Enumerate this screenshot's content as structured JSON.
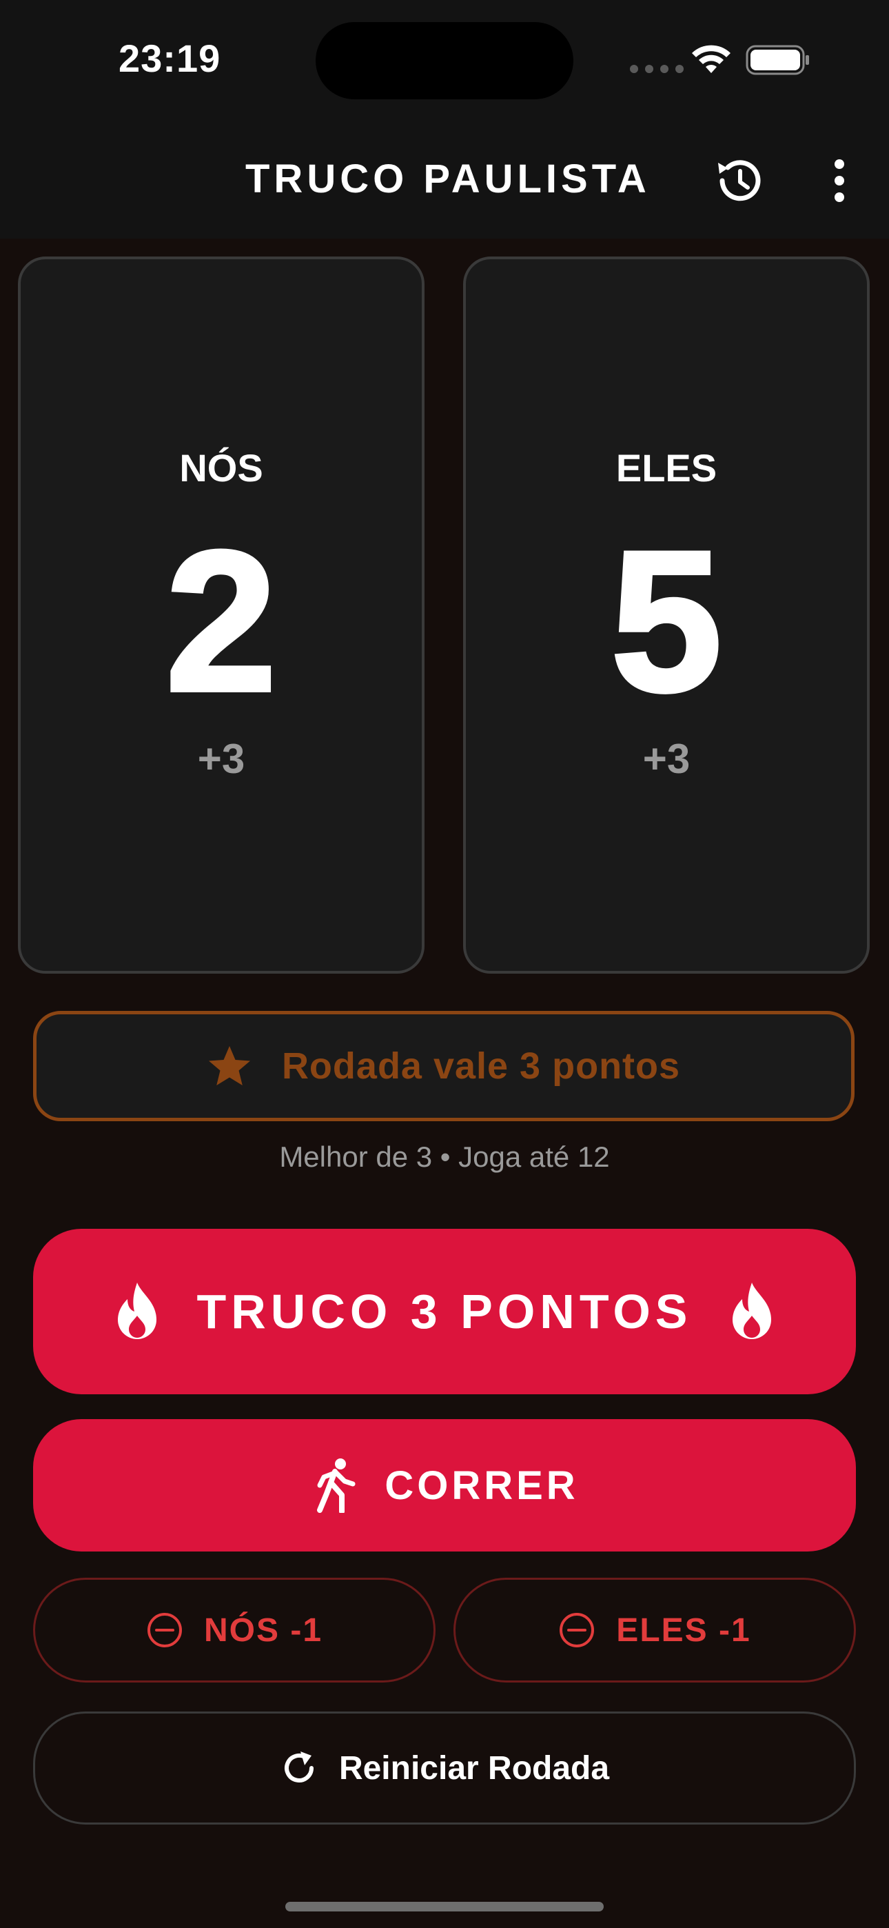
{
  "status_bar": {
    "time": "23:19"
  },
  "app_bar": {
    "title": "TRUCO PAULISTA",
    "history_icon": "history-icon",
    "menu_icon": "more-vertical-icon"
  },
  "teams": [
    {
      "name": "NÓS",
      "score": "2",
      "bonus": "+3"
    },
    {
      "name": "ELES",
      "score": "5",
      "bonus": "+3"
    }
  ],
  "round": {
    "label": "Rodada vale 3 pontos",
    "icon": "star-icon"
  },
  "match_info": "Melhor de 3 • Joga até 12",
  "actions": {
    "truco_label": "TRUCO 3 PONTOS",
    "run_label": "CORRER",
    "us_minus_label": "NÓS -1",
    "them_minus_label": "ELES -1",
    "reset_label": "Reiniciar Rodada"
  },
  "colors": {
    "background": "#150d0b",
    "card": "#1a1a1a",
    "accent_red": "#dc143c",
    "bronze": "#8b4513",
    "minus_red": "#e23c3c"
  }
}
